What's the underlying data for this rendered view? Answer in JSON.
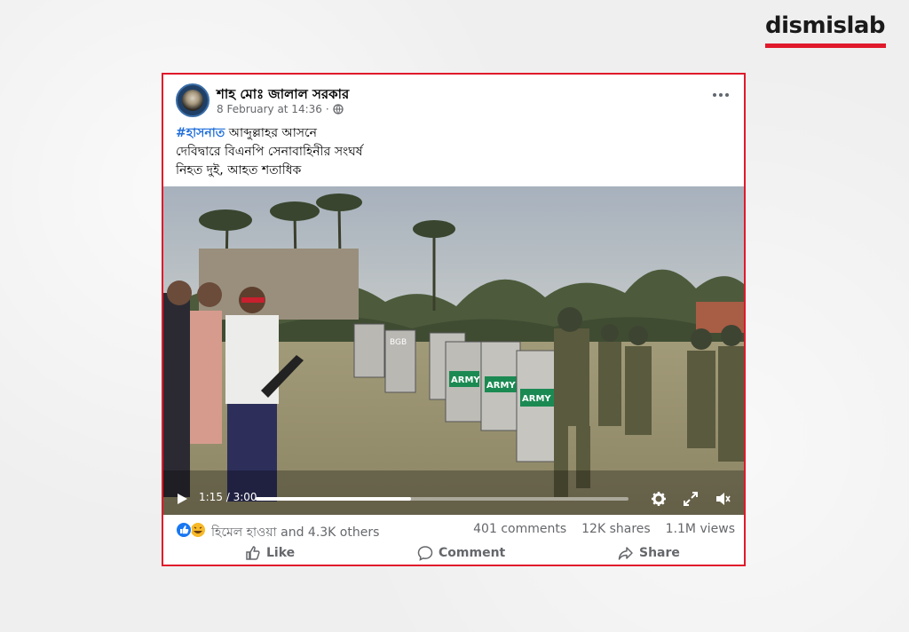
{
  "brand": {
    "name": "dismislab",
    "accent": "#e0192b"
  },
  "post": {
    "author": "শাহ মোঃ জালাল সরকার",
    "timestamp": "8 February at 14:36",
    "privacy_icon": "globe-icon",
    "more_icon": "more-options-icon",
    "hashtag": "#হাসনাত",
    "line1_rest": " আব্দুল্লাহর আসনে",
    "line2": "দেবিদ্বারে বিএনপি সেনাবাহিনীর সংঘর্ষ",
    "line3": "নিহত দুই, আহত শতাধিক"
  },
  "video": {
    "current_time": "1:15",
    "duration": "3:00",
    "time_label": "1:15 / 3:00",
    "progress_fraction": 0.417,
    "shield_label_army": "ARMY",
    "shield_label_bgb": "BGB",
    "controls": [
      "play-icon",
      "settings-icon",
      "fullscreen-icon",
      "volume-icon"
    ]
  },
  "reactions": {
    "icons": [
      "like-icon",
      "haha-icon"
    ],
    "names": "হিমেল হাওয়া and 4.3K others",
    "comments": "401 comments",
    "shares": "12K shares",
    "views": "1.1M views"
  },
  "actions": {
    "like": "Like",
    "comment": "Comment",
    "share": "Share"
  }
}
